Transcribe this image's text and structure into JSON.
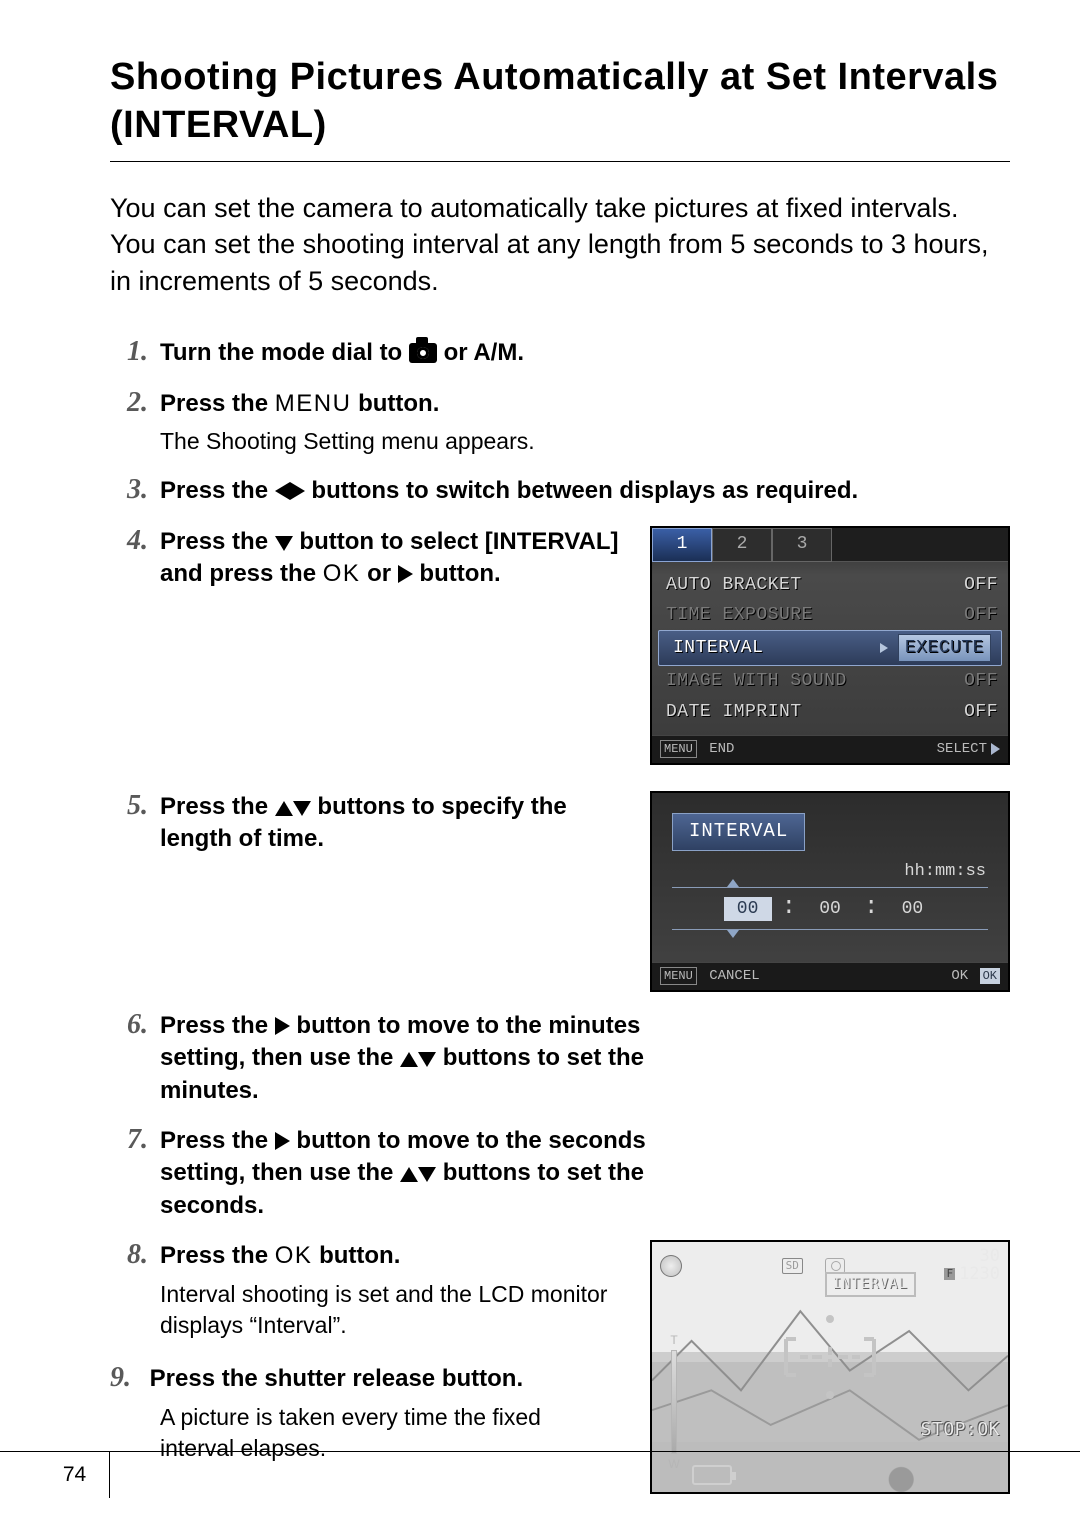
{
  "title": "Shooting Pictures Automatically at Set Intervals (INTERVAL)",
  "intro": {
    "p1": "You can set the camera to automatically take pictures at fixed intervals.",
    "p2": "You can set the shooting interval at any length from 5 seconds to 3 hours, in increments of 5 seconds."
  },
  "steps": {
    "s1": {
      "num": "1.",
      "a": "Turn the mode dial to ",
      "b": " or A/M."
    },
    "s2": {
      "num": "2.",
      "a": "Press the ",
      "menu": "MENU",
      "b": " button.",
      "sub": "The Shooting Setting menu appears."
    },
    "s3": {
      "num": "3.",
      "a": "Press the ",
      "b": " buttons to switch between displays as required."
    },
    "s4": {
      "num": "4.",
      "a": "Press the ",
      "b": " button to select [INTERVAL] and press the ",
      "ok": "OK",
      "c": " or ",
      "d": " button."
    },
    "s5": {
      "num": "5.",
      "a": "Press the ",
      "b": " buttons to specify the length of time."
    },
    "s6": {
      "num": "6.",
      "a": "Press the ",
      "b": " button to move to the minutes setting, then use the ",
      "c": " buttons to set the minutes."
    },
    "s7": {
      "num": "7.",
      "a": "Press the ",
      "b": " button to move to the seconds setting, then use the ",
      "c": " buttons to set the seconds."
    },
    "s8": {
      "num": "8.",
      "a": "Press the ",
      "ok": "OK",
      "b": " button.",
      "sub": "Interval shooting is set and the LCD monitor displays “Interval”."
    },
    "s9": {
      "num": "9.",
      "a": "Press the shutter release button.",
      "sub": "A picture is taken every time the fixed interval elapses."
    }
  },
  "lcd1": {
    "tabs": [
      "1",
      "2",
      "3"
    ],
    "rows": [
      {
        "label": "AUTO BRACKET",
        "value": "OFF"
      },
      {
        "label": "TIME EXPOSURE",
        "value": "OFF"
      },
      {
        "label": "INTERVAL",
        "value": "EXECUTE"
      },
      {
        "label": "IMAGE WITH SOUND",
        "value": "OFF"
      },
      {
        "label": "DATE IMPRINT",
        "value": "OFF"
      }
    ],
    "bottom": {
      "menu": "MENU",
      "end": "END",
      "select": "SELECT"
    }
  },
  "lcd2": {
    "title": "INTERVAL",
    "format": "hh:mm:ss",
    "hh": "00",
    "mm": "00",
    "ss": "00",
    "bottom": {
      "menu": "MENU",
      "cancel": "CANCEL",
      "ok": "OK",
      "okbadge": "OK"
    }
  },
  "lcd3": {
    "count": "30",
    "frames_prefix": "F",
    "frames": "1230",
    "interval": "INTERVAL",
    "stop": "STOP:OK",
    "sd": "SD",
    "zoom_t": "T",
    "zoom_w": "W"
  },
  "page_number": "74"
}
